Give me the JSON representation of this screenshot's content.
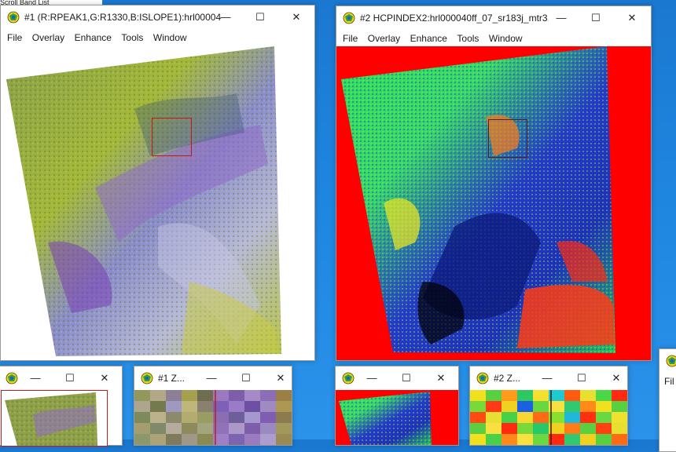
{
  "background_window_text": "Scroll Band List",
  "windows": [
    {
      "id": "w1",
      "title": "#1 (R:RPEAK1,G:R1330,B:ISLOPE1):hrl00004...",
      "menu": [
        "File",
        "Overlay",
        "Enhance",
        "Tools",
        "Window"
      ]
    },
    {
      "id": "w2",
      "title": "#2 HCPINDEX2:hrl000040ff_07_sr183j_mtr3...",
      "menu": [
        "File",
        "Overlay",
        "Enhance",
        "Tools",
        "Window"
      ]
    },
    {
      "id": "w3",
      "title": ""
    },
    {
      "id": "w4",
      "title": "#1 Z..."
    },
    {
      "id": "w5",
      "title": ""
    },
    {
      "id": "w6",
      "title": "#2 Z..."
    },
    {
      "id": "w7",
      "title": "",
      "menu_partial": "Fil"
    }
  ],
  "controls": {
    "minimize": "—",
    "maximize": "☐",
    "close": "✕"
  },
  "colors": {
    "roi": "#c41a1a",
    "index_background": "#ff0000"
  },
  "icons": {
    "app": "envi-globe-icon"
  }
}
